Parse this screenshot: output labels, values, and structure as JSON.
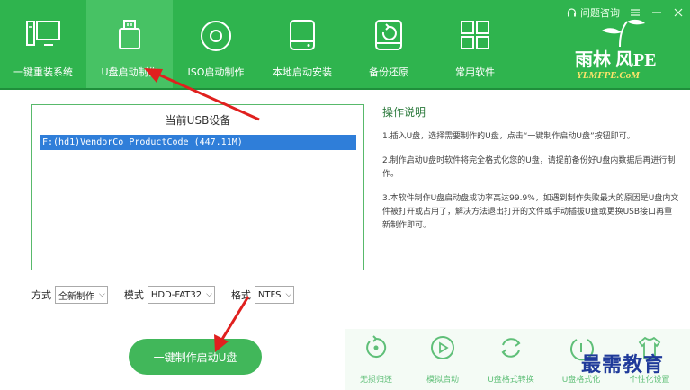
{
  "header": {
    "consult_label": "问题咨询",
    "tabs": [
      {
        "label": "一键重装系统",
        "icon": "monitor-icon"
      },
      {
        "label": "U盘启动制作",
        "icon": "usb-drive-icon"
      },
      {
        "label": "ISO启动制作",
        "icon": "disc-icon"
      },
      {
        "label": "本地启动安装",
        "icon": "hard-drive-icon"
      },
      {
        "label": "备份还原",
        "icon": "backup-disk-icon"
      },
      {
        "label": "常用软件",
        "icon": "grid-icon"
      }
    ],
    "active_tab": 1,
    "logo": {
      "main": "雨林 风PE",
      "sub": "YLMFPE.CoM"
    },
    "colors": {
      "header": "#2fb44e",
      "active_tab": "#47c264"
    }
  },
  "usb_panel": {
    "title": "当前USB设备",
    "devices": [
      "F:(hd1)VendorCo ProductCode (447.11M)"
    ]
  },
  "help": {
    "title": "操作说明",
    "steps": [
      "1.插入U盘，选择需要制作的U盘，点击“一键制作启动U盘”按钮即可。",
      "2.制作启动U盘时软件将完全格式化您的U盘，请提前备份好U盘内数据后再进行制作。",
      "3.本软件制作U盘启动盘成功率高达99.9%，如遇到制作失败最大的原因是U盘内文件被打开或占用了，解决方法退出打开的文件或手动插拔U盘或更换USB接口再重新制作即可。"
    ]
  },
  "options": {
    "mode_label": "方式",
    "mode_value": "全新制作",
    "pattern_label": "模式",
    "pattern_value": "HDD-FAT32",
    "format_label": "格式",
    "format_value": "NTFS"
  },
  "main_button": "一键制作启动U盘",
  "tools": [
    {
      "label": "无损归还",
      "icon": "restore-icon"
    },
    {
      "label": "模拟启动",
      "icon": "play-icon"
    },
    {
      "label": "U盘格式转换",
      "icon": "convert-icon"
    },
    {
      "label": "U盘格式化",
      "icon": "format-icon"
    },
    {
      "label": "个性化设置",
      "icon": "tshirt-icon"
    }
  ],
  "watermark": "最需教育"
}
